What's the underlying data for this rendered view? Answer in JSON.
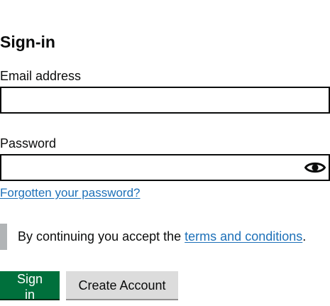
{
  "form": {
    "title": "Sign-in",
    "email": {
      "label": "Email address",
      "value": "",
      "placeholder": ""
    },
    "password": {
      "label": "Password",
      "value": "",
      "placeholder": "",
      "toggle_icon": "eye-icon"
    },
    "forgot_link": "Forgotten your password?",
    "terms": {
      "prefix": "By continuing you accept the ",
      "link": "terms and conditions",
      "suffix": "."
    },
    "buttons": {
      "sign_in": "Sign in",
      "create_account": "Create Account"
    }
  },
  "colors": {
    "link": "#1d70b8",
    "primary_button": "#00703c",
    "secondary_button": "#dcdcdc",
    "inset_bar": "#b1b4b6",
    "text": "#0b0c0c"
  }
}
